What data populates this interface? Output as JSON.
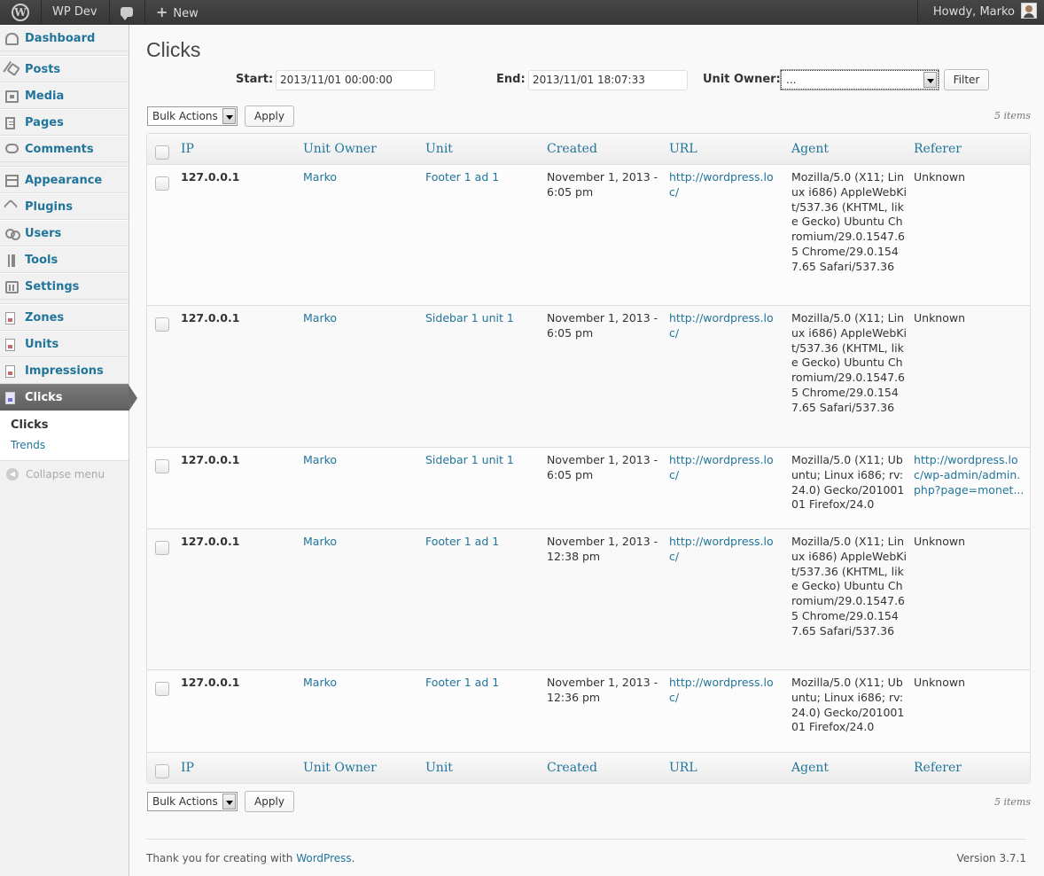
{
  "adminbar": {
    "site_name": "WP Dev",
    "new_label": "New",
    "account": "Howdy, Marko"
  },
  "menu": {
    "items": [
      {
        "label": "Dashboard",
        "icon": "dashboard-icon"
      },
      {
        "label": "Posts",
        "icon": "pin-icon"
      },
      {
        "label": "Media",
        "icon": "media-icon"
      },
      {
        "label": "Pages",
        "icon": "pages-icon"
      },
      {
        "label": "Comments",
        "icon": "comment-icon"
      },
      {
        "label": "Appearance",
        "icon": "appearance-icon"
      },
      {
        "label": "Plugins",
        "icon": "plugin-icon"
      },
      {
        "label": "Users",
        "icon": "users-icon"
      },
      {
        "label": "Tools",
        "icon": "tools-icon"
      },
      {
        "label": "Settings",
        "icon": "settings-icon"
      },
      {
        "label": "Zones",
        "icon": "document-icon"
      },
      {
        "label": "Units",
        "icon": "document-icon"
      },
      {
        "label": "Impressions",
        "icon": "document-icon"
      },
      {
        "label": "Clicks",
        "icon": "document-icon"
      }
    ],
    "submenu": [
      "Clicks",
      "Trends"
    ],
    "collapse": "Collapse menu"
  },
  "page": {
    "title": "Clicks",
    "filter": {
      "start_label": "Start:",
      "start_value": "2013/11/01 00:00:00",
      "end_label": "End:",
      "end_value": "2013/11/01 18:07:33",
      "owner_label": "Unit Owner:",
      "owner_value": "...",
      "button": "Filter"
    },
    "bulk_actions": "Bulk Actions",
    "apply": "Apply",
    "items_count": "5 items"
  },
  "table": {
    "columns": [
      "IP",
      "Unit Owner",
      "Unit",
      "Created",
      "URL",
      "Agent",
      "Referer"
    ],
    "rows": [
      {
        "ip": "127.0.0.1",
        "owner": "Marko",
        "unit": "Footer 1 ad 1",
        "created": "November 1, 2013 - 6:05 pm",
        "url": "http://wordpress.loc/",
        "agent": "Mozilla/5.0 (X11; Linux i686) AppleWebKit/537.36 (KHTML, like Gecko) Ubuntu Chromium/29.0.1547.65 Chrome/29.0.1547.65 Safari/537.36",
        "referer": "Unknown"
      },
      {
        "ip": "127.0.0.1",
        "owner": "Marko",
        "unit": "Sidebar 1 unit 1",
        "created": "November 1, 2013 - 6:05 pm",
        "url": "http://wordpress.loc/",
        "agent": "Mozilla/5.0 (X11; Linux i686) AppleWebKit/537.36 (KHTML, like Gecko) Ubuntu Chromium/29.0.1547.65 Chrome/29.0.1547.65 Safari/537.36",
        "referer": "Unknown"
      },
      {
        "ip": "127.0.0.1",
        "owner": "Marko",
        "unit": "Sidebar 1 unit 1",
        "created": "November 1, 2013 - 6:05 pm",
        "url": "http://wordpress.loc/",
        "agent": "Mozilla/5.0 (X11; Ubuntu; Linux i686; rv:24.0) Gecko/20100101 Firefox/24.0",
        "referer": "http://wordpress.loc/wp-admin/admin.php?page=monet..."
      },
      {
        "ip": "127.0.0.1",
        "owner": "Marko",
        "unit": "Footer 1 ad 1",
        "created": "November 1, 2013 - 12:38 pm",
        "url": "http://wordpress.loc/",
        "agent": "Mozilla/5.0 (X11; Linux i686) AppleWebKit/537.36 (KHTML, like Gecko) Ubuntu Chromium/29.0.1547.65 Chrome/29.0.1547.65 Safari/537.36",
        "referer": "Unknown"
      },
      {
        "ip": "127.0.0.1",
        "owner": "Marko",
        "unit": "Footer 1 ad 1",
        "created": "November 1, 2013 - 12:36 pm",
        "url": "http://wordpress.loc/",
        "agent": "Mozilla/5.0 (X11; Ubuntu; Linux i686; rv:24.0) Gecko/20100101 Firefox/24.0",
        "referer": "Unknown"
      }
    ]
  },
  "footer": {
    "thanks_prefix": "Thank you for creating with ",
    "thanks_link": "WordPress",
    "thanks_suffix": ".",
    "version": "Version 3.7.1"
  },
  "colors": {
    "link": "#21759b",
    "adminbar": "#464646",
    "current_menu": "#6a6a6a"
  }
}
